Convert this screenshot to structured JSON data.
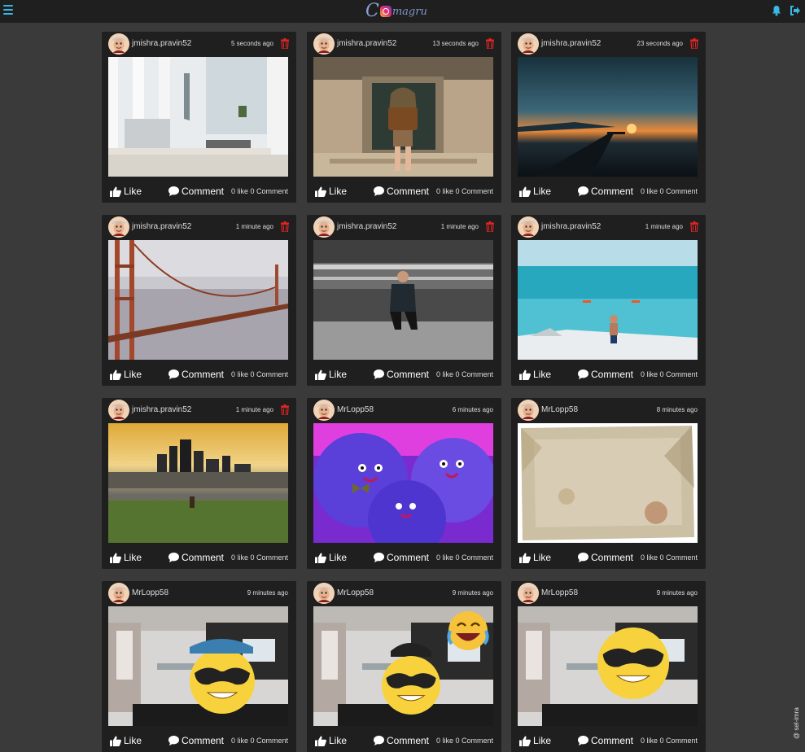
{
  "app": {
    "logo_text": "magru",
    "logo_initial": "C",
    "credit": "@ sel-imra",
    "accent_color": "#39b7e5",
    "delete_color": "#e02424"
  },
  "actions": {
    "like_label": "Like",
    "comment_label": "Comment"
  },
  "posts": [
    {
      "user": "jmishra.pravin52",
      "time": "5 seconds ago",
      "stats": "0 like 0 Comment",
      "can_delete": true,
      "image": "desk-workspace"
    },
    {
      "user": "jmishra.pravin52",
      "time": "13 seconds ago",
      "stats": "0 like 0 Comment",
      "can_delete": true,
      "image": "doorway-backpack"
    },
    {
      "user": "jmishra.pravin52",
      "time": "23 seconds ago",
      "stats": "0 like 0 Comment",
      "can_delete": true,
      "image": "sunset-pier"
    },
    {
      "user": "jmishra.pravin52",
      "time": "1 minute ago",
      "stats": "0 like 0 Comment",
      "can_delete": true,
      "image": "golden-gate-bridge"
    },
    {
      "user": "jmishra.pravin52",
      "time": "1 minute ago",
      "stats": "0 like 0 Comment",
      "can_delete": true,
      "image": "man-in-garage"
    },
    {
      "user": "jmishra.pravin52",
      "time": "1 minute ago",
      "stats": "0 like 0 Comment",
      "can_delete": true,
      "image": "boat-turquoise-sea"
    },
    {
      "user": "jmishra.pravin52",
      "time": "1 minute ago",
      "stats": "0 like 0 Comment",
      "can_delete": true,
      "image": "city-skyline"
    },
    {
      "user": "MrLopp58",
      "time": "6 minutes ago",
      "stats": "0 like 0 Comment",
      "can_delete": false,
      "image": "purple-monsters"
    },
    {
      "user": "MrLopp58",
      "time": "8 minutes ago",
      "stats": "0 like 0 Comment",
      "can_delete": false,
      "image": "old-paper"
    },
    {
      "user": "MrLopp58",
      "time": "9 minutes ago",
      "stats": "0 like 0 Comment",
      "can_delete": false,
      "image": "office-sunglasses-emoji"
    },
    {
      "user": "MrLopp58",
      "time": "9 minutes ago",
      "stats": "0 like 0 Comment",
      "can_delete": false,
      "image": "office-two-emojis"
    },
    {
      "user": "MrLopp58",
      "time": "9 minutes ago",
      "stats": "0 like 0 Comment",
      "can_delete": false,
      "image": "office-sunglasses-emoji-2"
    }
  ]
}
